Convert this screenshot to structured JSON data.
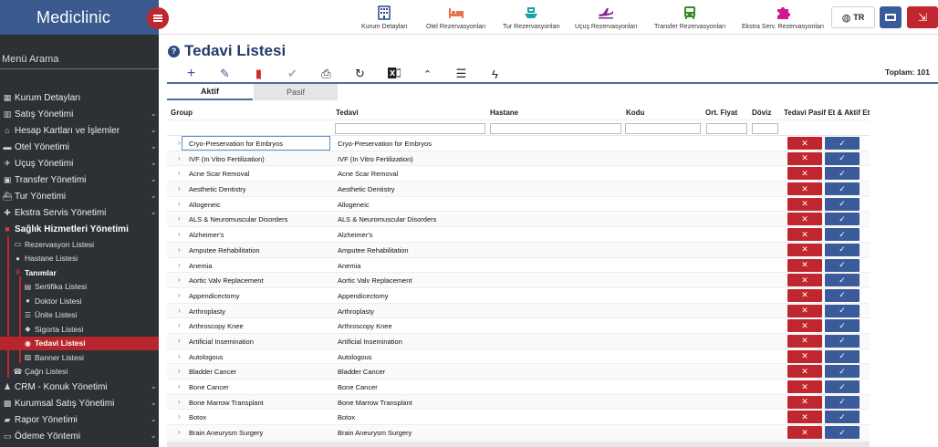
{
  "brand": {
    "name": "Mediclinic"
  },
  "sidebar": {
    "search_label": "Menü Arama",
    "items": [
      {
        "label": "Kurum Detayları",
        "icon": "building-icon",
        "chevron": false
      },
      {
        "label": "Satış Yönetimi",
        "icon": "chart-icon",
        "chevron": true
      },
      {
        "label": "Hesap Kartları ve İşlemler",
        "icon": "bank-icon",
        "chevron": true
      },
      {
        "label": "Otel Yönetimi",
        "icon": "bed-icon",
        "chevron": true
      },
      {
        "label": "Uçuş Yönetimi",
        "icon": "plane-icon",
        "chevron": true
      },
      {
        "label": "Transfer Yönetimi",
        "icon": "bus-icon",
        "chevron": true
      },
      {
        "label": "Tur Yönetimi",
        "icon": "ship-icon",
        "chevron": true
      },
      {
        "label": "Ekstra Servis Yönetimi",
        "icon": "puzzle-icon",
        "chevron": true
      },
      {
        "label": "Sağlık Hizmetleri Yönetimi",
        "icon": "medkit-icon",
        "chevron": false,
        "active": true
      }
    ],
    "health_sub": [
      {
        "label": "Rezervasyon Listesi",
        "icon": "monitor-icon"
      },
      {
        "label": "Hastane Listesi",
        "icon": "pin-icon"
      },
      {
        "label": "Tanımlar",
        "icon": "gear-icon",
        "bold": true
      }
    ],
    "definitions": [
      {
        "label": "Sertifika Listesi",
        "icon": "cert-icon"
      },
      {
        "label": "Doktor Listesi",
        "icon": "user-icon"
      },
      {
        "label": "Ünite Listesi",
        "icon": "list-icon"
      },
      {
        "label": "Sigorta Listesi",
        "icon": "shield-icon"
      },
      {
        "label": "Tedavi Listesi",
        "icon": "drop-icon",
        "selected": true
      },
      {
        "label": "Banner Listesi",
        "icon": "image-icon"
      }
    ],
    "after_sub": [
      {
        "label": "Çağrı Listesi",
        "icon": "phone-icon"
      }
    ],
    "bottom_items": [
      {
        "label": "CRM - Konuk Yönetimi",
        "icon": "people-icon",
        "chevron": true
      },
      {
        "label": "Kurumsal Satış Yönetimi",
        "icon": "briefcase-icon",
        "chevron": true
      },
      {
        "label": "Rapor Yönetimi",
        "icon": "folder-icon",
        "chevron": true
      },
      {
        "label": "Ödeme Yöntemi",
        "icon": "card-icon",
        "chevron": true
      }
    ]
  },
  "topnav": [
    {
      "label": "Kurum Detayları",
      "icon": "building-icon",
      "color": "#2a4a8a"
    },
    {
      "label": "Otel Rezervasyonları",
      "icon": "bed-icon",
      "color": "#e8734a"
    },
    {
      "label": "Tur Rezervasyonları",
      "icon": "ship-icon",
      "color": "#17a2a8"
    },
    {
      "label": "Uçuş Rezervasyonları",
      "icon": "plane-icon",
      "color": "#7a2a8a"
    },
    {
      "label": "Transfer Rezervasyonları",
      "icon": "bus-icon",
      "color": "#3a8a2a"
    },
    {
      "label": "Ekstra Serv. Rezervasyonları",
      "icon": "puzzle-icon",
      "color": "#d01a8a"
    }
  ],
  "header": {
    "lang": "TR"
  },
  "page": {
    "title": "Tedavi Listesi",
    "total_label": "Toplam: 101",
    "tabs": [
      "Aktif",
      "Pasif"
    ]
  },
  "toolbar": [
    {
      "icon": "plus-icon",
      "color": "#3a5a9a"
    },
    {
      "icon": "pencil-icon",
      "color": "#3a5a9a"
    },
    {
      "icon": "trash-icon",
      "color": "#d02a2a"
    },
    {
      "icon": "check-icon",
      "color": "#aaaaaa"
    },
    {
      "icon": "print-icon",
      "color": "#222222"
    },
    {
      "icon": "refresh-icon",
      "color": "#222222"
    },
    {
      "icon": "excel-icon",
      "color": "#222222"
    },
    {
      "icon": "caret-up-icon",
      "color": "#222222"
    },
    {
      "icon": "menu-icon",
      "color": "#222222"
    },
    {
      "icon": "bolt-icon",
      "color": "#222222"
    }
  ],
  "grid": {
    "columns": [
      "Group",
      "Tedavi",
      "Hastane",
      "Kodu",
      "Ort. Fiyat",
      "Döviz",
      "Tedavi Pasif Et & Aktif Et"
    ],
    "rows": [
      [
        "Cryo-Preservation for Embryos",
        "Cryo-Preservation for Embryos"
      ],
      [
        "IVF (In Vitro Fertilization)",
        "IVF (In Vitro Fertilization)"
      ],
      [
        "Acne Scar Removal",
        "Acne Scar Removal"
      ],
      [
        "Aesthetic Dentistry",
        "Aesthetic Dentistry"
      ],
      [
        "Allogeneic",
        "Allogeneic"
      ],
      [
        "ALS & Neuromuscular Disorders",
        "ALS & Neuromuscular Disorders"
      ],
      [
        "Alzheimer's",
        "Alzheimer's"
      ],
      [
        "Amputee Rehabilitation",
        "Amputee Rehabilitation"
      ],
      [
        "Anemia",
        "Anemia"
      ],
      [
        "Aortic Valv Replacement",
        "Aortic Valv Replacement"
      ],
      [
        "Appendicectomy",
        "Appendicectomy"
      ],
      [
        "Arthroplasty",
        "Arthroplasty"
      ],
      [
        "Arthroscopy Knee",
        "Arthroscopy Knee"
      ],
      [
        "Artificial Insemination",
        "Artificial Insemination"
      ],
      [
        "Autologous",
        "Autologous"
      ],
      [
        "Bladder Cancer",
        "Bladder Cancer"
      ],
      [
        "Bone Cancer",
        "Bone Cancer"
      ],
      [
        "Bone Marrow Transplant",
        "Bone Marrow Transplant"
      ],
      [
        "Botox",
        "Botox"
      ],
      [
        "Brain Aneurysm Surgery",
        "Brain Aneurysm Surgery"
      ]
    ]
  }
}
